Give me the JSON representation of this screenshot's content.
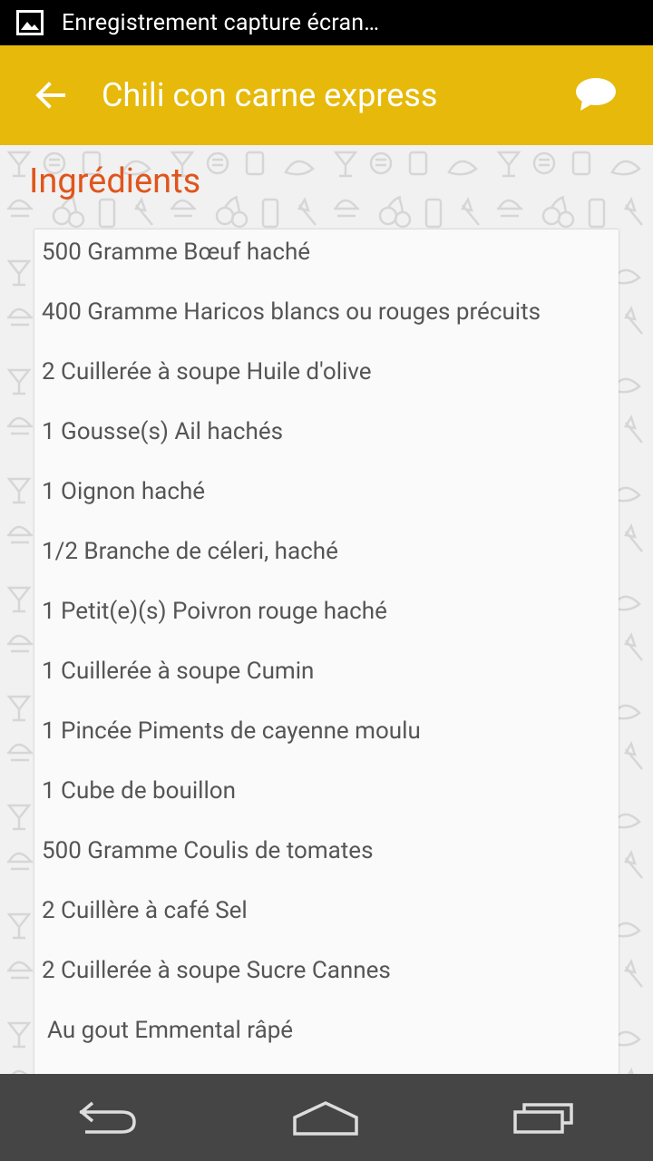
{
  "status_bar": {
    "notification_text": "Enregistrement capture écran…",
    "icon": "image-icon"
  },
  "app_bar": {
    "title": "Chili con carne express",
    "back_icon": "arrow-back-icon",
    "comment_icon": "chat-bubble-icon",
    "color": "#e6b90a"
  },
  "section": {
    "title": "Ingrédients",
    "title_color": "#e0551c"
  },
  "ingredients": [
    {
      "text": "500  Gramme Bœuf haché"
    },
    {
      "text": "400  Gramme Haricos blancs ou rouges précuits"
    },
    {
      "text": "2  Cuillerée à soupe Huile d'olive"
    },
    {
      "text": "1  Gousse(s) Ail hachés"
    },
    {
      "text": "1   Oignon haché"
    },
    {
      "text": "1/2  Branche de céleri, haché"
    },
    {
      "text": "1  Petit(e)(s) Poivron rouge haché"
    },
    {
      "text": "1  Cuillerée à soupe Cumin"
    },
    {
      "text": "1  Pincée Piments de cayenne moulu"
    },
    {
      "text": "1   Cube de bouillon"
    },
    {
      "text": "500  Gramme Coulis de tomates"
    },
    {
      "text": "2  Cuillère à café Sel"
    },
    {
      "text": "2  Cuillerée à soupe Sucre Cannes"
    },
    {
      "text": "Au gout Emmental râpé"
    }
  ],
  "nav_bar": {
    "back_icon": "nav-back-icon",
    "home_icon": "nav-home-icon",
    "recents_icon": "nav-recents-icon"
  }
}
